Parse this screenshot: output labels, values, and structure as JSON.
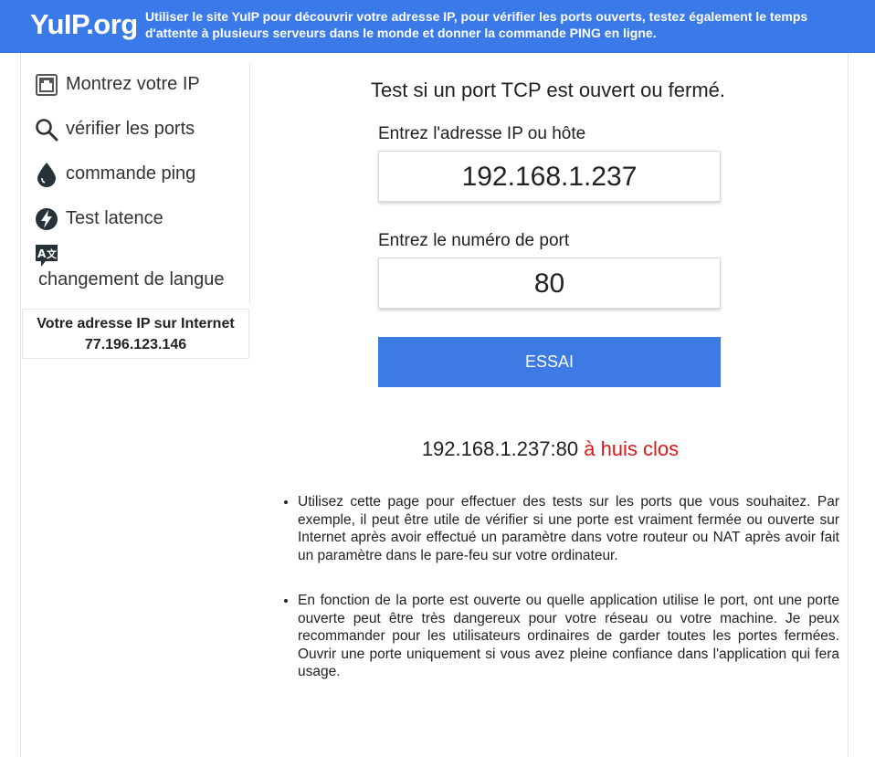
{
  "header": {
    "logo": "YuIP.org",
    "tagline": "Utiliser le site YuIP pour découvrir votre adresse IP, pour vérifier les ports ouverts, testez également le temps d'attente à plusieurs serveurs dans le monde et donner la commande PING en ligne.",
    "background": "#3a7ae8"
  },
  "sidebar": {
    "items": [
      {
        "label": "Montrez votre IP",
        "icon": "network-port-icon"
      },
      {
        "label": "vérifier les ports",
        "icon": "search-icon"
      },
      {
        "label": "commande ping",
        "icon": "drop-icon"
      },
      {
        "label": "Test latence",
        "icon": "lightning-icon"
      },
      {
        "label": "changement de langue",
        "icon": "translate-icon"
      }
    ],
    "ip_box": {
      "label": "Votre adresse IP sur Internet",
      "ip": "77.196.123.146"
    }
  },
  "main": {
    "title": "Test si un port TCP est ouvert ou fermé.",
    "host_label": "Entrez l'adresse IP ou hôte",
    "host_value": "192.168.1.237",
    "port_label": "Entrez le numéro de port",
    "port_value": "80",
    "button_label": "ESSAI",
    "button_color": "#3d7ae3",
    "result": {
      "target": "192.168.1.237:80",
      "status": "à huis clos",
      "status_color": "#e01818"
    },
    "notes": [
      "Utilisez cette page pour effectuer des tests sur les ports que vous souhaitez. Par exemple, il peut être utile de vérifier si une porte est vraiment fermée ou ouverte sur Internet après avoir effectué un paramètre dans votre routeur ou NAT après avoir fait un paramètre dans le pare-feu sur votre ordinateur.",
      "En fonction de la porte est ouverte ou quelle application utilise le port, ont une porte ouverte peut être très dangereux pour votre réseau ou votre machine. Je peux recommander pour les utilisateurs ordinaires de garder toutes les portes fermées. Ouvrir une porte uniquement si vous avez pleine confiance dans l'application qui fera usage."
    ]
  }
}
